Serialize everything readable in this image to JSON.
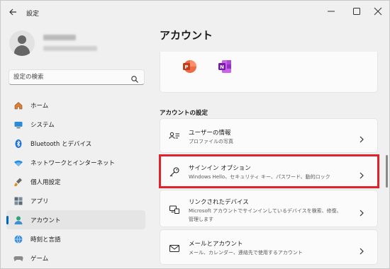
{
  "window": {
    "title": "設定",
    "back_icon": "back-arrow-icon",
    "controls": [
      "minimize-icon",
      "maximize-icon",
      "close-icon"
    ]
  },
  "search": {
    "placeholder": "設定の検索",
    "icon": "search-icon"
  },
  "sidebar": {
    "items": [
      {
        "label": "ホーム",
        "icon": "home-icon",
        "active": false
      },
      {
        "label": "システム",
        "icon": "system-icon",
        "active": false
      },
      {
        "label": "Bluetooth とデバイス",
        "icon": "bluetooth-icon",
        "active": false
      },
      {
        "label": "ネットワークとインターネット",
        "icon": "wifi-icon",
        "active": false
      },
      {
        "label": "個人用設定",
        "icon": "brush-icon",
        "active": false
      },
      {
        "label": "アプリ",
        "icon": "apps-icon",
        "active": false
      },
      {
        "label": "アカウント",
        "icon": "account-icon",
        "active": true
      },
      {
        "label": "時刻と言語",
        "icon": "globe-icon",
        "active": false
      },
      {
        "label": "ゲーム",
        "icon": "game-icon",
        "active": false
      }
    ]
  },
  "main": {
    "page_title": "アカウント",
    "apps": [
      "powerpoint-icon",
      "onenote-icon"
    ],
    "section_title": "アカウントの設定",
    "cards": [
      {
        "title": "ユーザーの情報",
        "subtitle": "プロファイルの写真",
        "icon": "user-info-icon"
      },
      {
        "title": "サインイン オプション",
        "subtitle": "Windows Hello、セキュリティ キー、パスワード、動的ロック",
        "icon": "key-icon",
        "highlighted": true
      },
      {
        "title": "リンクされたデバイス",
        "subtitle": "Microsoft アカウントでサインインしているデバイスを検索、修復、",
        "subtitle2": "管理します",
        "icon": "linked-devices-icon"
      },
      {
        "title": "メールとアカウント",
        "subtitle": "メール、カレンダー、連絡先で使用するアカウント",
        "icon": "mail-icon"
      }
    ]
  },
  "colors": {
    "accent": "#0067c0",
    "highlight": "#e0222b"
  }
}
